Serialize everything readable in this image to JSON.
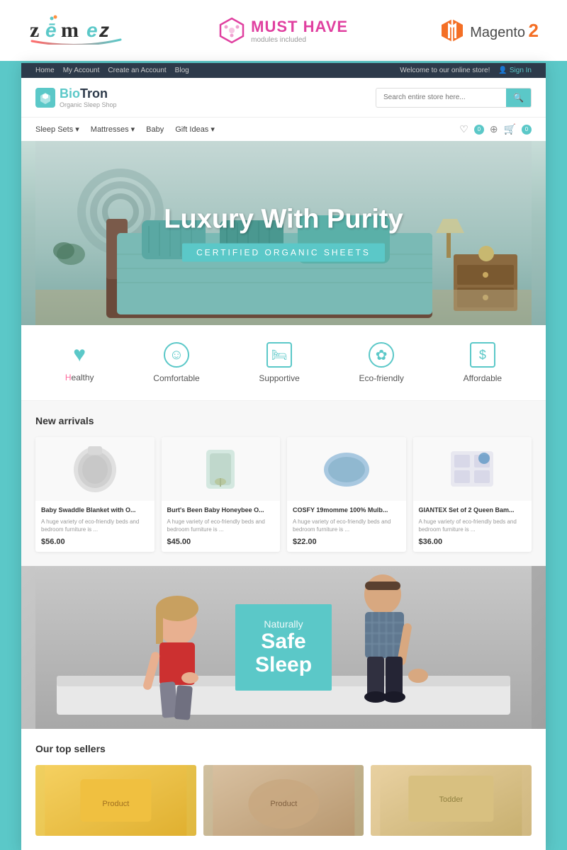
{
  "branding": {
    "zemes_logo": "zēmez",
    "musthave_label": "MUST HAVE",
    "musthave_sub": "modules included",
    "magento_label": "Magento",
    "magento_version": "2"
  },
  "store": {
    "top_nav": {
      "links": [
        "Home",
        "My Account",
        "Create an Account",
        "Blog"
      ],
      "welcome": "Welcome to our online store!",
      "signin": "Sign In"
    },
    "logo": {
      "bio": "Bio",
      "tron": "Tron",
      "tagline": "Organic Sleep Shop"
    },
    "search": {
      "placeholder": "Search entire store here..."
    },
    "nav_links": [
      {
        "label": "Sleep Sets",
        "has_dropdown": true
      },
      {
        "label": "Mattresses",
        "has_dropdown": true
      },
      {
        "label": "Baby"
      },
      {
        "label": "Gift Ideas",
        "has_dropdown": true
      }
    ],
    "hero": {
      "title": "Luxury With Purity",
      "subtitle": "CERTIFIED ORGANIC SHEETS"
    },
    "features": [
      {
        "label": "Healthy",
        "icon": "♥",
        "highlight": "H"
      },
      {
        "label": "Comfortable",
        "icon": "☺"
      },
      {
        "label": "Supportive",
        "icon": "🛏"
      },
      {
        "label": "Eco-friendly",
        "icon": "✿"
      },
      {
        "label": "Affordable",
        "icon": "💲"
      }
    ],
    "new_arrivals": {
      "title": "New arrivals",
      "products": [
        {
          "name": "Baby Swaddle Blanket with O...",
          "desc": "A huge variety of eco-friendly beds and bedroom furniture is ...",
          "price": "$56.00"
        },
        {
          "name": "Burt's Been Baby Honeybee O...",
          "desc": "A huge variety of eco-friendly beds and bedroom furniture is ...",
          "price": "$45.00"
        },
        {
          "name": "COSFY 19momme 100% Mulb...",
          "desc": "A huge variety of eco-friendly beds and bedroom furniture is ...",
          "price": "$22.00"
        },
        {
          "name": "GIANTEX Set of 2 Queen Bam...",
          "desc": "A huge variety of eco-friendly beds and bedroom furniture is ...",
          "price": "$36.00"
        }
      ]
    },
    "safe_sleep": {
      "naturally": "Naturally",
      "safe": "Safe",
      "sleep": "Sleep"
    },
    "top_sellers": {
      "title": "Our top sellers"
    }
  }
}
